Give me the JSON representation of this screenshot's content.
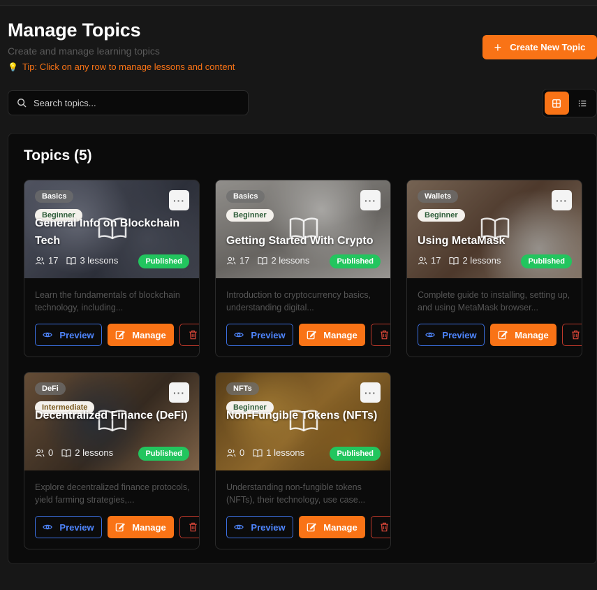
{
  "header": {
    "title": "Manage Topics",
    "subtitle": "Create and manage learning topics",
    "tip": "Tip: Click on any row to manage lessons and content",
    "create_label": "Create New Topic"
  },
  "search": {
    "placeholder": "Search topics..."
  },
  "view": {
    "selected": "grid",
    "options": [
      "grid-icon",
      "list-icon"
    ]
  },
  "panel": {
    "title": "Topics (5)"
  },
  "colors": {
    "accent": "#f97316",
    "published": "#22c55e",
    "preview": "#4f86ff",
    "delete": "#c0392b"
  },
  "topics": [
    {
      "category": "Basics",
      "level": "Beginner",
      "title": "General Info on Blockchain Tech",
      "students": "17",
      "lessons": "3 lessons",
      "status": "Published",
      "description": "Learn the fundamentals of blockchain technology, including...",
      "preview_label": "Preview",
      "manage_label": "Manage",
      "more": "···"
    },
    {
      "category": "Basics",
      "level": "Beginner",
      "title": "Getting Started With Crypto",
      "students": "17",
      "lessons": "2 lessons",
      "status": "Published",
      "description": "Introduction to cryptocurrency basics, understanding digital...",
      "preview_label": "Preview",
      "manage_label": "Manage",
      "more": "···"
    },
    {
      "category": "Wallets",
      "level": "Beginner",
      "title": "Using MetaMask",
      "students": "17",
      "lessons": "2 lessons",
      "status": "Published",
      "description": "Complete guide to installing, setting up, and using MetaMask browser...",
      "preview_label": "Preview",
      "manage_label": "Manage",
      "more": "···"
    },
    {
      "category": "DeFi",
      "level": "Intermediate",
      "title": "Decentralized Finance (DeFi)",
      "students": "0",
      "lessons": "2 lessons",
      "status": "Published",
      "description": "Explore decentralized finance protocols, yield farming strategies,...",
      "preview_label": "Preview",
      "manage_label": "Manage",
      "more": "···"
    },
    {
      "category": "NFTs",
      "level": "Beginner",
      "title": "Non-Fungible Tokens (NFTs)",
      "students": "0",
      "lessons": "1 lessons",
      "status": "Published",
      "description": "Understanding non-fungible tokens (NFTs), their technology, use case...",
      "preview_label": "Preview",
      "manage_label": "Manage",
      "more": "···"
    }
  ]
}
